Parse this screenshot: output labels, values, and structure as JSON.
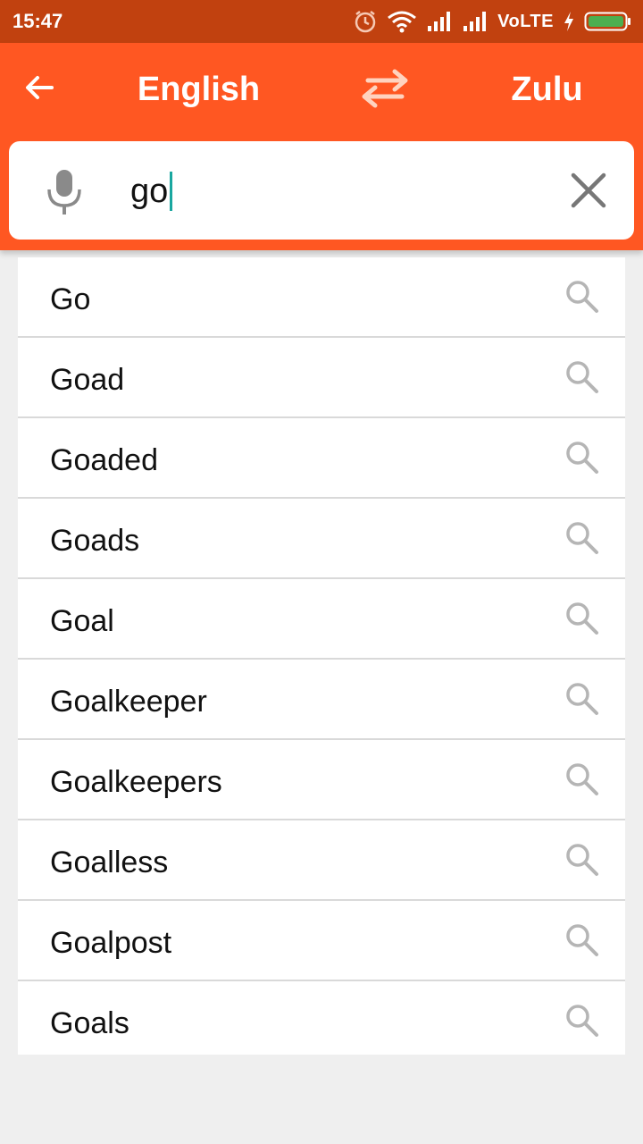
{
  "status_bar": {
    "time": "15:47",
    "network": "VoLTE",
    "icons": [
      "alarm-icon",
      "wifi-icon",
      "signal-icon",
      "signal-icon",
      "charging-icon",
      "battery-icon"
    ]
  },
  "header": {
    "source_language": "English",
    "target_language": "Zulu",
    "icons": [
      "back-arrow-icon",
      "swap-icon"
    ]
  },
  "search": {
    "value": "go",
    "icons": [
      "microphone-icon",
      "close-icon"
    ]
  },
  "suggestions": [
    {
      "label": "Go"
    },
    {
      "label": "Goad"
    },
    {
      "label": "Goaded"
    },
    {
      "label": "Goads"
    },
    {
      "label": "Goal"
    },
    {
      "label": "Goalkeeper"
    },
    {
      "label": "Goalkeepers"
    },
    {
      "label": "Goalless"
    },
    {
      "label": "Goalpost"
    },
    {
      "label": "Goals"
    }
  ],
  "colors": {
    "status_bar": "#c1410f",
    "app_bar": "#ff5722",
    "caret": "#1aa7a0",
    "background": "#efefef"
  }
}
